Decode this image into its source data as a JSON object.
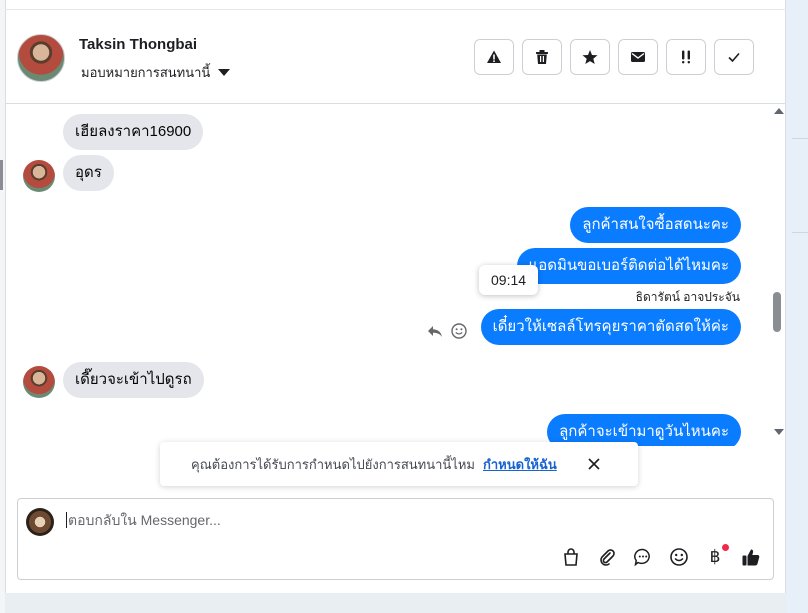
{
  "header": {
    "contact_name": "Taksin Thongbai",
    "assign_label": "มอบหมายการสนทนานี้"
  },
  "icons": {
    "report": "warning-icon",
    "delete": "trash-icon",
    "star": "star-icon",
    "mail": "envelope-icon",
    "priority": "double-exclamation-icon",
    "done": "check-icon"
  },
  "messages": [
    {
      "from": "contact",
      "text": "เฮียลงราคา16900"
    },
    {
      "from": "contact",
      "text": "อุดร"
    },
    {
      "from": "page",
      "text": "ลูกค้าสนใจซื้อสดนะคะ"
    },
    {
      "from": "page",
      "text": "แอดมินขอเบอร์ติดต่อได้ไหมคะ"
    },
    {
      "from": "page",
      "text": "เดี๋ยวให้เซลล์โทรคุยราคาตัดสดให้ค่ะ"
    },
    {
      "from": "contact",
      "text": "เดี๊ยวจะเข้าไปดูรถ"
    },
    {
      "from": "page",
      "text": "ลูกค้าจะเข้ามาดูวันไหนคะ"
    }
  ],
  "sender_label": "ธิดารัตน์ อาจประจัน",
  "tooltip_time": "09:14",
  "notice": {
    "text": "คุณต้องการได้รับการกำหนดไปยังการสนทนานี้ไหม",
    "link": "กำหนดให้ฉัน"
  },
  "composer": {
    "placeholder": "ตอบกลับใน Messenger..."
  },
  "colors": {
    "accent": "#0a7cff",
    "incoming_bubble": "#e4e6eb",
    "link": "#1763cf",
    "notification_dot": "#f02849"
  }
}
